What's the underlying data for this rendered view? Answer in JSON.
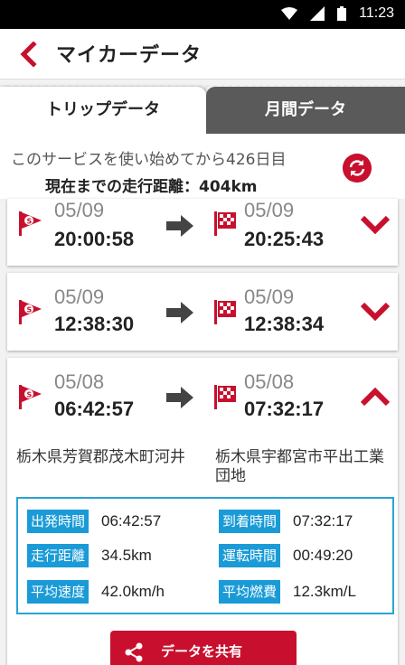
{
  "status_bar": {
    "time": "11:23"
  },
  "app_bar": {
    "title": "マイカーデータ"
  },
  "tabs": [
    {
      "label": "トリップデータ",
      "active": true
    },
    {
      "label": "月間データ",
      "active": false
    }
  ],
  "summary": {
    "days_text": "このサービスを使い始めてから426日目",
    "distance_text": "現在までの走行距離：404km"
  },
  "trips": [
    {
      "start_date": "05/09",
      "start_time": "20:00:58",
      "end_date": "05/09",
      "end_time": "20:25:43",
      "expanded": false
    },
    {
      "start_date": "05/09",
      "start_time": "12:38:30",
      "end_date": "05/09",
      "end_time": "12:38:34",
      "expanded": false
    },
    {
      "start_date": "05/08",
      "start_time": "06:42:57",
      "end_date": "05/08",
      "end_time": "07:32:17",
      "expanded": true
    }
  ],
  "expanded_trip": {
    "start_address": "栃木県芳賀郡茂木町河井",
    "end_address": "栃木県宇都宮市平出工業団地",
    "details": {
      "departure_label": "出発時間",
      "departure_value": "06:42:57",
      "arrival_label": "到着時間",
      "arrival_value": "07:32:17",
      "distance_label": "走行距離",
      "distance_value": "34.5km",
      "drive_time_label": "運転時間",
      "drive_time_value": "00:49:20",
      "avg_speed_label": "平均速度",
      "avg_speed_value": "42.0km/h",
      "avg_fuel_label": "平均燃費",
      "avg_fuel_value": "12.3km/L"
    }
  },
  "share_button": {
    "label": "データを共有"
  },
  "colors": {
    "accent": "#c8102e",
    "label_blue": "#1a9bd7",
    "tab_inactive": "#5a5a5a"
  }
}
